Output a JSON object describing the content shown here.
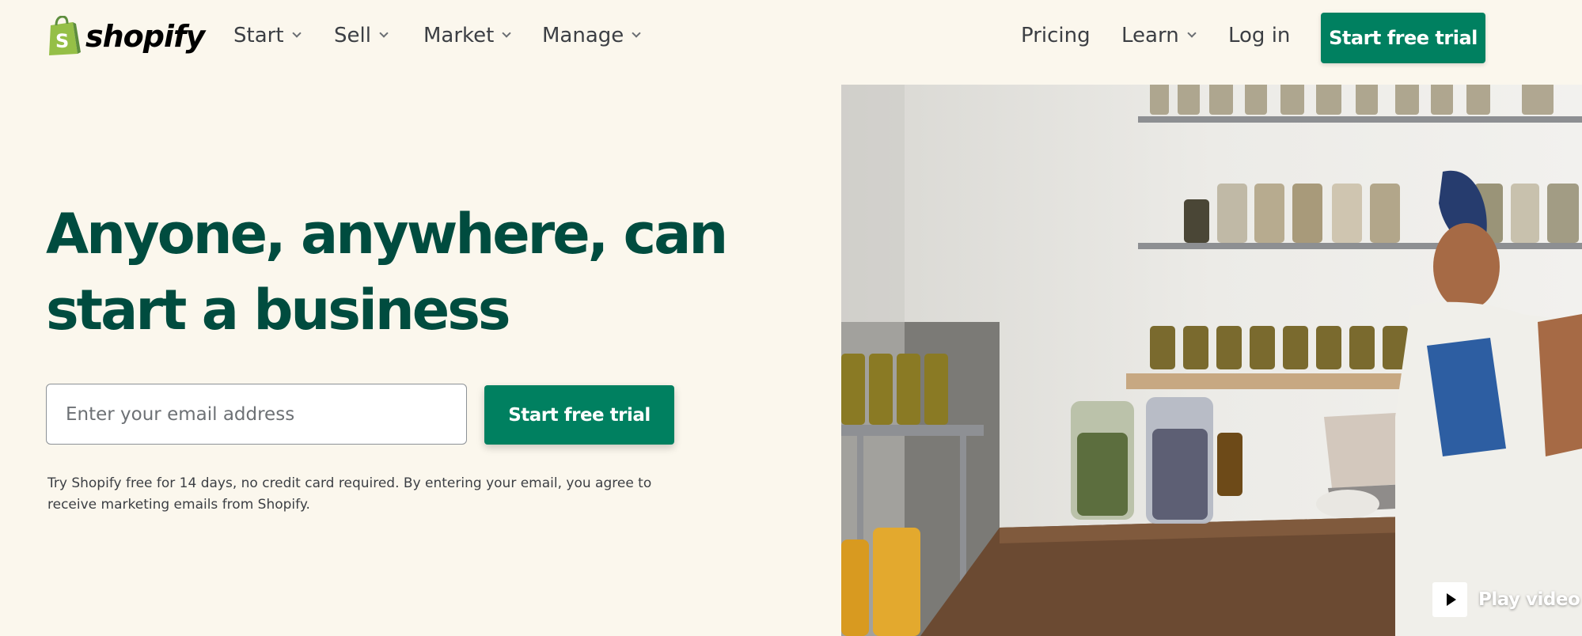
{
  "brand": {
    "name": "shopify",
    "accent": "#008060",
    "headline_color": "#004c3f",
    "background": "#fbf7ed"
  },
  "nav": {
    "items": [
      {
        "label": "Start",
        "dropdown": true
      },
      {
        "label": "Sell",
        "dropdown": true
      },
      {
        "label": "Market",
        "dropdown": true
      },
      {
        "label": "Manage",
        "dropdown": true
      }
    ],
    "right": {
      "pricing": "Pricing",
      "learn": "Learn",
      "login": "Log in",
      "cta": "Start free trial"
    }
  },
  "hero": {
    "headline_line1": "Anyone, anywhere, can",
    "headline_line2": "start a business",
    "email_placeholder": "Enter your email address",
    "email_value": "",
    "cta": "Start free trial",
    "disclaimer": "Try Shopify free for 14 days, no credit card required. By entering your email, you agree to receive marketing emails from Shopify."
  },
  "media": {
    "play_label": "Play video",
    "icon": "play-icon"
  }
}
